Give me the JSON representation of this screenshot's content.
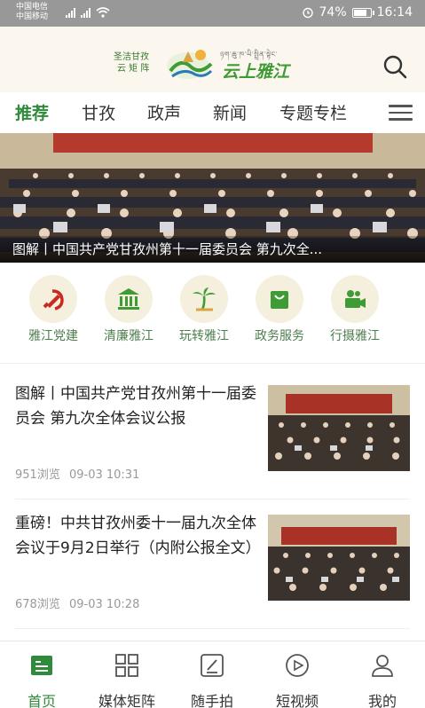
{
  "status_bar": {
    "carrier_1": "中国电信",
    "carrier_2": "中国移动",
    "net_1": "2G",
    "net_2": "4G",
    "battery": "74%",
    "time": "16:14",
    "icons": [
      "signal-icon",
      "wifi-icon",
      "alarm-icon",
      "battery-icon"
    ]
  },
  "header": {
    "slogan_1": "圣洁甘孜",
    "slogan_2": "云 矩 阵",
    "title": "云上雅江",
    "tibetan": "ཉག་ཆུ་ཁ་ཡི་སྤྲིན་སྟེང་",
    "search_icon": "search-icon"
  },
  "tabs": [
    {
      "label": "推荐",
      "active": true
    },
    {
      "label": "甘孜",
      "active": false
    },
    {
      "label": "政声",
      "active": false
    },
    {
      "label": "新闻",
      "active": false
    },
    {
      "label": "专题专栏",
      "active": false
    }
  ],
  "banner": {
    "caption": "图解丨中国共产党甘孜州第十一届委员会 第九次全..."
  },
  "quick_links": [
    {
      "label": "雅江党建",
      "icon": "party-emblem-icon"
    },
    {
      "label": "清廉雅江",
      "icon": "building-icon"
    },
    {
      "label": "玩转雅江",
      "icon": "palm-tree-icon"
    },
    {
      "label": "政务服务",
      "icon": "shopping-bag-icon"
    },
    {
      "label": "行摄雅江",
      "icon": "video-camera-icon"
    }
  ],
  "articles": [
    {
      "title": "图解丨中国共产党甘孜州第十一届委员会 第九次全体会议公报",
      "views": "951浏览",
      "date": "09-03 10:31"
    },
    {
      "title": "重磅！中共甘孜州委十一届九次全体会议于9月2日举行（内附公报全文）",
      "views": "678浏览",
      "date": "09-03 10:28"
    }
  ],
  "bottom_nav": [
    {
      "label": "首页",
      "icon": "home-icon",
      "active": true
    },
    {
      "label": "媒体矩阵",
      "icon": "grid-icon",
      "active": false
    },
    {
      "label": "随手拍",
      "icon": "edit-icon",
      "active": false
    },
    {
      "label": "短视频",
      "icon": "play-icon",
      "active": false
    },
    {
      "label": "我的",
      "icon": "user-icon",
      "active": false
    }
  ],
  "colors": {
    "accent": "#2f8a3a",
    "header_bg": "#fbf7ee",
    "status_bar": "#989898",
    "quick_label": "#4d7e4d"
  }
}
